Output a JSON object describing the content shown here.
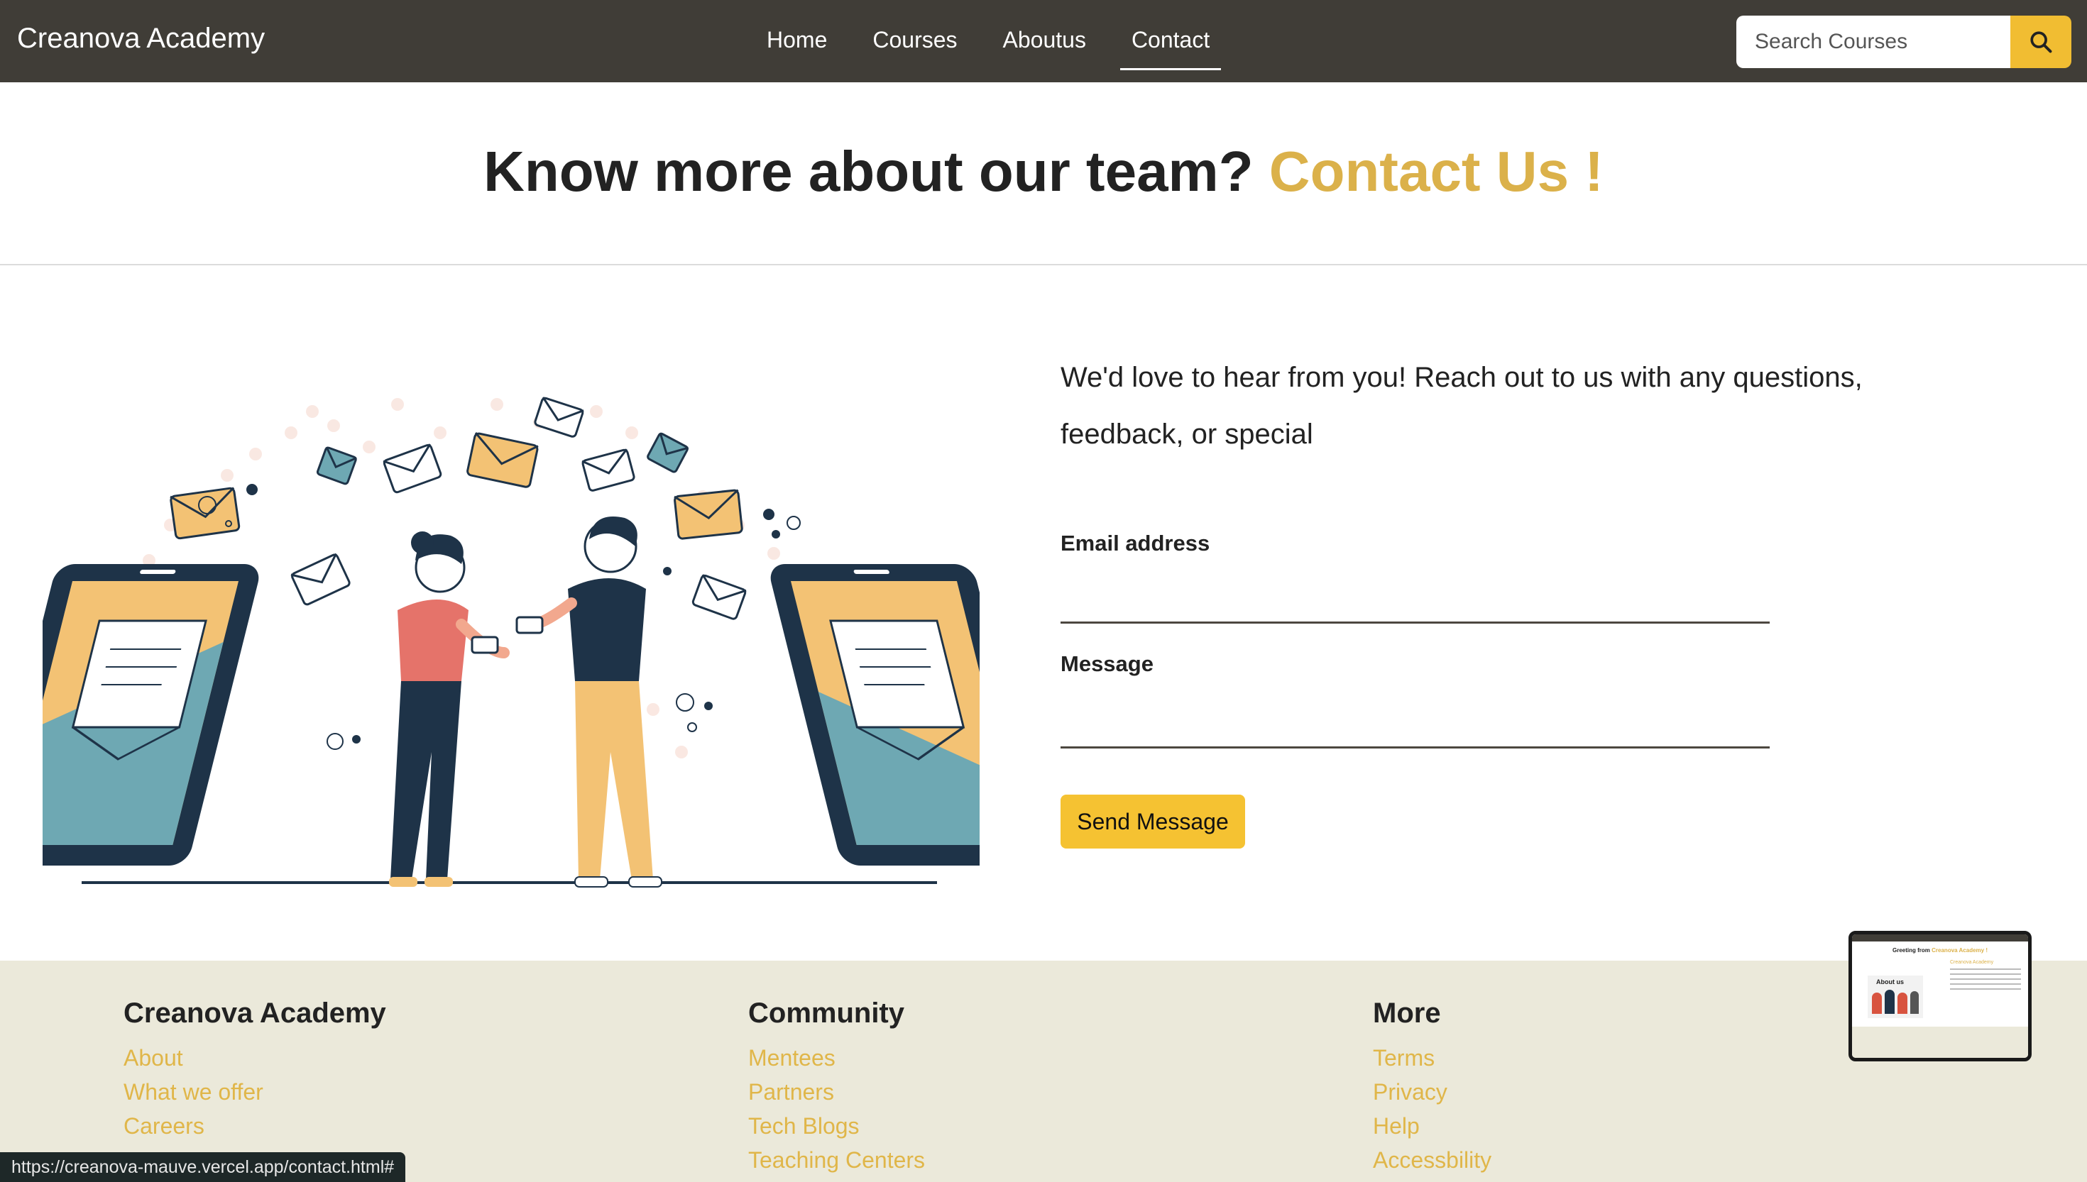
{
  "navbar": {
    "brand": "Creanova Academy",
    "links": [
      {
        "label": "Home"
      },
      {
        "label": "Courses"
      },
      {
        "label": "Aboutus"
      },
      {
        "label": "Contact"
      }
    ],
    "active_link": "Contact",
    "search_placeholder": "Search Courses",
    "search_icon": "magnifier-icon"
  },
  "heading": {
    "text": "Know more about our team?",
    "accent": "Contact Us !"
  },
  "contact": {
    "intro": "We'd love to hear from you! Reach out to us with any questions, feedback, or special",
    "email_label": "Email address",
    "message_label": "Message",
    "send_label": "Send Message"
  },
  "footer": {
    "columns": [
      {
        "title": "Creanova Academy",
        "links": [
          "About",
          "What we offer",
          "Careers"
        ]
      },
      {
        "title": "Community",
        "links": [
          "Mentees",
          "Partners",
          "Tech Blogs",
          "Teaching Centers"
        ]
      },
      {
        "title": "More",
        "links": [
          "Terms",
          "Privacy",
          "Help",
          "Accessbility"
        ]
      }
    ]
  },
  "preview": {
    "heading_plain": "Greeting from",
    "heading_accent": "Creanova Academy !",
    "subheading": "Creanova Academy",
    "caption": "About us"
  },
  "status_url": "https://creanova-mauve.vercel.app/contact.html#",
  "colors": {
    "navbar": "#403d37",
    "accent": "#dbb14a",
    "button": "#f5c232",
    "footer_bg": "#ebe9da",
    "link": "#e0b649"
  }
}
